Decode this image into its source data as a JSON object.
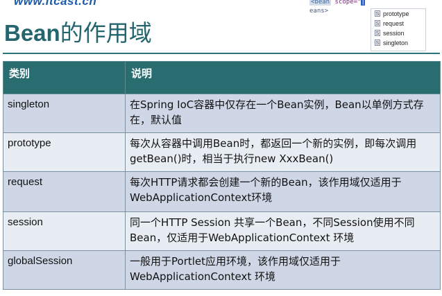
{
  "header": {
    "site_url": "www.itcast.cn",
    "title_latin": "Bean",
    "title_cjk": "的作用域"
  },
  "code_popup": {
    "tag": "<bean",
    "attr": "scope=\"",
    "cursor": "|",
    "line2": "eans>",
    "suggestions": [
      {
        "icon": "S",
        "label": "prototype"
      },
      {
        "icon": "S",
        "label": "request"
      },
      {
        "icon": "S",
        "label": "session"
      },
      {
        "icon": "S",
        "label": "singleton"
      }
    ]
  },
  "table": {
    "headers": [
      "类别",
      "说明"
    ],
    "rows": [
      {
        "name": "singleton",
        "desc": "在Spring IoC容器中仅存在一个Bean实例，Bean以单例方式存在，默认值"
      },
      {
        "name": "prototype",
        "desc": "每次从容器中调用Bean时，都返回一个新的实例，即每次调用getBean()时，相当于执行new XxxBean()"
      },
      {
        "name": "request",
        "desc": "每次HTTP请求都会创建一个新的Bean，该作用域仅适用于WebApplicationContext环境"
      },
      {
        "name": "session",
        "desc": "同一个HTTP Session 共享一个Bean，不同Session使用不同Bean，仅适用于WebApplicationContext 环境"
      },
      {
        "name": "globalSession",
        "desc": "一般用于Portlet应用环境，该作用域仅适用于WebApplicationContext 环境"
      }
    ]
  }
}
